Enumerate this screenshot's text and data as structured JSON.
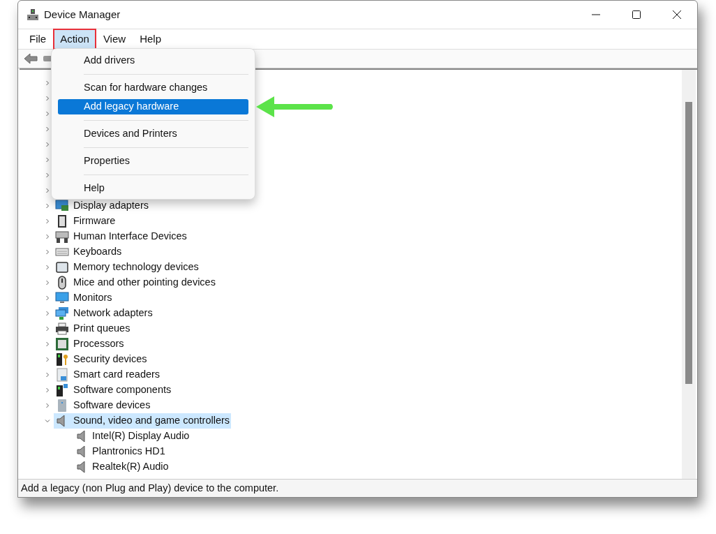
{
  "window": {
    "title": "Device Manager"
  },
  "menu_bar": [
    {
      "label": "File",
      "selected": false,
      "highlighted": false
    },
    {
      "label": "Action",
      "selected": true,
      "highlighted": true
    },
    {
      "label": "View",
      "selected": false,
      "highlighted": false
    },
    {
      "label": "Help",
      "selected": false,
      "highlighted": false
    }
  ],
  "action_menu": [
    {
      "kind": "item",
      "label": "Add drivers",
      "selected": false
    },
    {
      "kind": "separator"
    },
    {
      "kind": "item",
      "label": "Scan for hardware changes",
      "selected": false
    },
    {
      "kind": "item",
      "label": "Add legacy hardware",
      "selected": true
    },
    {
      "kind": "separator"
    },
    {
      "kind": "item",
      "label": "Devices and Printers",
      "selected": false
    },
    {
      "kind": "separator"
    },
    {
      "kind": "item",
      "label": "Properties",
      "selected": false
    },
    {
      "kind": "separator"
    },
    {
      "kind": "item",
      "label": "Help",
      "selected": false
    }
  ],
  "tree": {
    "covered_rows": [
      {
        "expanded": false
      },
      {
        "expanded": false
      },
      {
        "expanded": false
      },
      {
        "expanded": false
      },
      {
        "expanded": false
      },
      {
        "expanded": false
      },
      {
        "expanded": false
      },
      {
        "expanded": false
      }
    ],
    "items": [
      {
        "label": "Display adapters",
        "expanded": false,
        "selected": false
      },
      {
        "label": "Firmware",
        "expanded": false,
        "selected": false
      },
      {
        "label": "Human Interface Devices",
        "expanded": false,
        "selected": false
      },
      {
        "label": "Keyboards",
        "expanded": false,
        "selected": false
      },
      {
        "label": "Memory technology devices",
        "expanded": false,
        "selected": false
      },
      {
        "label": "Mice and other pointing devices",
        "expanded": false,
        "selected": false
      },
      {
        "label": "Monitors",
        "expanded": false,
        "selected": false
      },
      {
        "label": "Network adapters",
        "expanded": false,
        "selected": false
      },
      {
        "label": "Print queues",
        "expanded": false,
        "selected": false
      },
      {
        "label": "Processors",
        "expanded": false,
        "selected": false
      },
      {
        "label": "Security devices",
        "expanded": false,
        "selected": false
      },
      {
        "label": "Smart card readers",
        "expanded": false,
        "selected": false
      },
      {
        "label": "Software components",
        "expanded": false,
        "selected": false
      },
      {
        "label": "Software devices",
        "expanded": false,
        "selected": false
      },
      {
        "label": "Sound, video and game controllers",
        "expanded": true,
        "selected": true,
        "children": [
          {
            "label": "Intel(R) Display Audio"
          },
          {
            "label": "Plantronics HD1"
          },
          {
            "label": "Realtek(R) Audio"
          }
        ]
      }
    ]
  },
  "status_bar": {
    "text": "Add a legacy (non Plug and Play) device to the computer."
  }
}
